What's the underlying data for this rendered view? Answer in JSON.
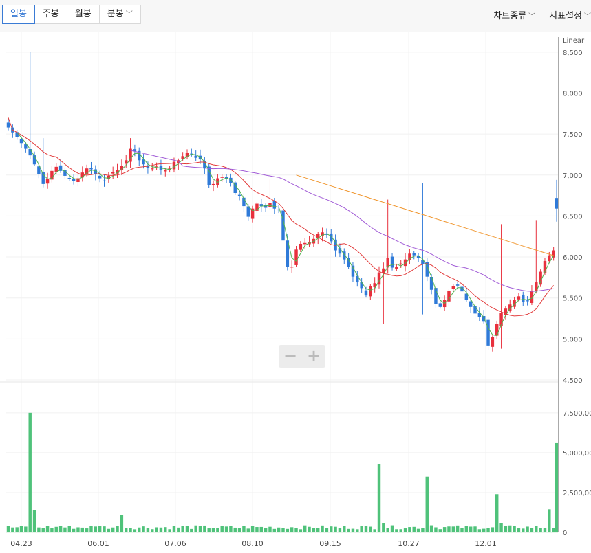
{
  "tabs": [
    {
      "label": "일봉",
      "active": true
    },
    {
      "label": "주봉",
      "active": false
    },
    {
      "label": "월봉",
      "active": false
    },
    {
      "label": "분봉",
      "active": false,
      "dropdown": true
    }
  ],
  "menu": {
    "chart_type": "차트종류",
    "indicator_settings": "지표설정"
  },
  "zoom": {
    "out": "−",
    "in": "+"
  },
  "colors": {
    "up": "#e8303d",
    "down": "#2f7ad8",
    "volume": "#4fc27a",
    "ma5": "#4fb34f",
    "ma20": "#e23b3b",
    "ma60": "#a05ad6",
    "ma120": "#f0962e"
  },
  "chart_data": {
    "type": "candlestick",
    "price_axis": {
      "scale": "Linear",
      "ticks": [
        "8,500",
        "8,000",
        "7,500",
        "7,000",
        "6,500",
        "6,000",
        "5,500",
        "5,000",
        "4,500"
      ],
      "range": [
        4500,
        8750
      ]
    },
    "volume_axis": {
      "ticks": [
        "7,500,000",
        "5,000,000",
        "2,500,000",
        "0"
      ],
      "range": [
        0,
        9000000
      ]
    },
    "x_ticks": [
      "04.23",
      "06.01",
      "07.06",
      "08.10",
      "09.15",
      "10.27",
      "12.01"
    ],
    "closes": [
      7580,
      7520,
      7460,
      7390,
      7320,
      7240,
      7130,
      7010,
      6890,
      6950,
      7050,
      7100,
      7050,
      6990,
      6950,
      6930,
      6960,
      7030,
      7080,
      7070,
      7010,
      6960,
      6930,
      6990,
      7040,
      7060,
      7110,
      7180,
      7320,
      7290,
      7180,
      7130,
      7090,
      7080,
      7110,
      7060,
      7060,
      7080,
      7160,
      7180,
      7230,
      7270,
      7260,
      7210,
      7190,
      7080,
      6880,
      6890,
      6960,
      6980,
      6950,
      6900,
      6780,
      6740,
      6620,
      6490,
      6590,
      6650,
      6620,
      6600,
      6660,
      6590,
      6570,
      6200,
      5880,
      5880,
      6090,
      6160,
      6170,
      6180,
      6220,
      6280,
      6300,
      6270,
      6190,
      6080,
      6040,
      5970,
      5880,
      5760,
      5690,
      5620,
      5530,
      5640,
      5680,
      5810,
      5860,
      5990,
      5870,
      5880,
      5920,
      5970,
      6040,
      6020,
      5990,
      5910,
      5760,
      5600,
      5430,
      5390,
      5480,
      5590,
      5640,
      5650,
      5580,
      5480,
      5390,
      5310,
      5270,
      5210,
      4920,
      5020,
      5180,
      5320,
      5370,
      5420,
      5480,
      5520,
      5450,
      5460,
      5580,
      5690,
      5820,
      5950,
      6020,
      6080
    ],
    "volumes": [
      "read from chart: spikes ~7,500,000 near 04.23, ~4,300,000 before 10.27, ~3,600,000 at 10.27, ~2,400,000 before 12.01, ~5,600,000 at last bar"
    ]
  }
}
